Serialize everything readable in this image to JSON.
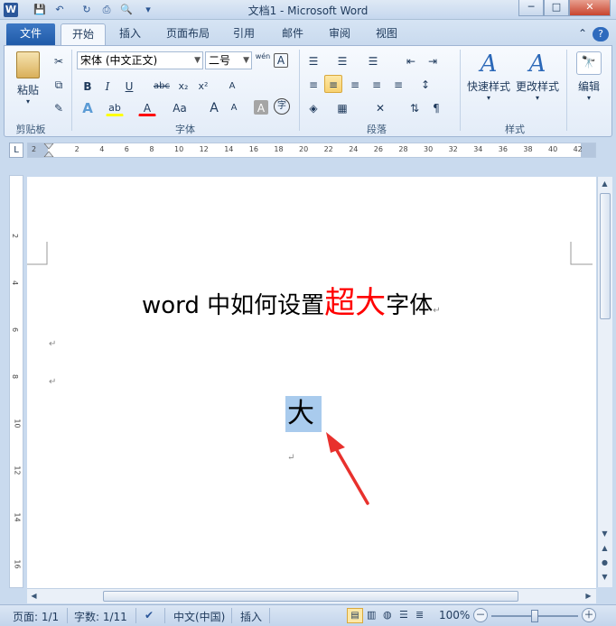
{
  "window": {
    "title": "文档1 - Microsoft Word",
    "app_icon": "W",
    "minimize": "─",
    "maximize": "□",
    "close": "✕"
  },
  "quick_access": {
    "save_icon": "💾",
    "undo_icon": "↶",
    "redo_icon": "↻",
    "print_icon": "⎙",
    "preview_icon": "🔍",
    "customize_icon": "▾"
  },
  "tabs": [
    "文件",
    "开始",
    "插入",
    "页面布局",
    "引用",
    "邮件",
    "审阅",
    "视图"
  ],
  "help": {
    "collapse_icon": "⌃",
    "help_icon": "?"
  },
  "ribbon": {
    "clipboard": {
      "label": "剪贴板",
      "paste": "粘贴",
      "cut_icon": "✂",
      "copy_icon": "⧉",
      "format_painter_icon": "✎"
    },
    "font": {
      "label": "字体",
      "font_name": "宋体 (中文正文)",
      "font_size": "二号",
      "bold": "B",
      "italic": "I",
      "underline": "U",
      "strike": "abc",
      "subscript": "x₂",
      "superscript": "x²",
      "grow": "A",
      "shrink": "A",
      "change_case": "Aa",
      "clear_format_icon": "A",
      "phonetic": "wén",
      "border_char": "A",
      "text_effect": "A",
      "highlight": "ab",
      "font_color": "A",
      "char_shade": "A",
      "enclose": "字"
    },
    "paragraph": {
      "label": "段落",
      "bullets_icon": "☰",
      "numbering_icon": "☰",
      "multilevel_icon": "☰",
      "decrease_indent_icon": "⇤",
      "increase_indent_icon": "⇥",
      "align_left_icon": "≡",
      "align_center_icon": "≡",
      "align_right_icon": "≡",
      "justify_icon": "≡",
      "distribute_icon": "≡",
      "line_spacing_icon": "↕",
      "shading_icon": "◈",
      "borders_icon": "▦",
      "chinese_layout_icon": "✕",
      "sort_icon": "⇅",
      "show_marks_icon": "¶"
    },
    "styles": {
      "label": "样式",
      "quick_styles": "快速样式",
      "change_styles": "更改样式"
    },
    "editing": {
      "label": "编辑",
      "find_icon": "🔭"
    }
  },
  "ruler": {
    "h_ticks": [
      "2",
      "2",
      "4",
      "6",
      "8",
      "10",
      "12",
      "14",
      "16",
      "18",
      "20",
      "22",
      "24",
      "26",
      "28",
      "30",
      "32",
      "34",
      "36",
      "38",
      "40",
      "42"
    ],
    "v_ticks": [
      "2",
      "4",
      "6",
      "8",
      "10",
      "12",
      "14",
      "16"
    ],
    "corner": "L"
  },
  "document": {
    "title_prefix": "word 中如何设置",
    "title_emph": "超大",
    "title_suffix": "字体",
    "para_mark": "↵",
    "selected_char": "大",
    "accent_red": "#ff0000",
    "arrow_color": "#e8312d"
  },
  "status": {
    "page": "页面: 1/1",
    "words": "字数: 1/11",
    "language": "中文(中国)",
    "mode": "插入",
    "zoom": "100%",
    "zoom_out": "－",
    "zoom_in": "＋"
  }
}
